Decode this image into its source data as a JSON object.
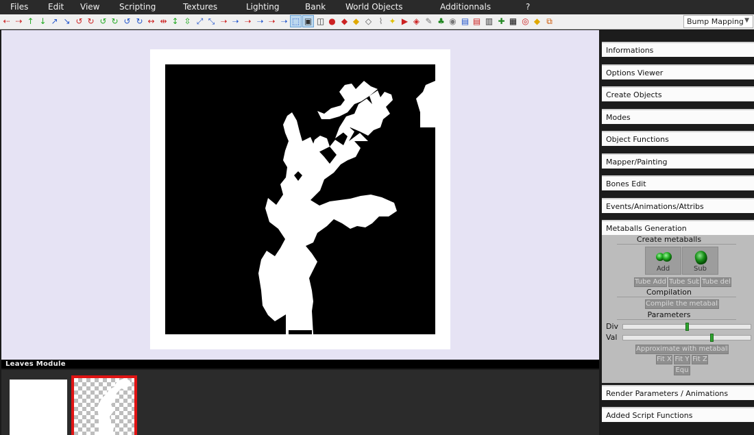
{
  "menu": [
    "Files",
    "Edit",
    "View",
    "Scripting",
    "Textures",
    "Lighting",
    "Bank",
    "World Objects",
    "Additionnals",
    "?"
  ],
  "toolbar": {
    "icons": [
      {
        "name": "arrow-left-icon",
        "glyph": "⇠",
        "color": "#cc2222"
      },
      {
        "name": "arrow-right-icon",
        "glyph": "⇢",
        "color": "#cc2222"
      },
      {
        "name": "axis-y-up-icon",
        "glyph": "↑",
        "color": "#22aa22"
      },
      {
        "name": "axis-y-down-icon",
        "glyph": "↓",
        "color": "#22aa22"
      },
      {
        "name": "axis-z-up-icon",
        "glyph": "↗",
        "color": "#2255cc"
      },
      {
        "name": "axis-z-down-icon",
        "glyph": "↘",
        "color": "#2255cc"
      },
      {
        "name": "rotate-x-icon",
        "glyph": "↺",
        "color": "#cc2222"
      },
      {
        "name": "rotate-x-back-icon",
        "glyph": "↻",
        "color": "#cc2222"
      },
      {
        "name": "rotate-y-icon",
        "glyph": "↺",
        "color": "#22aa22"
      },
      {
        "name": "rotate-y-back-icon",
        "glyph": "↻",
        "color": "#22aa22"
      },
      {
        "name": "rotate-z-icon",
        "glyph": "↺",
        "color": "#2255cc"
      },
      {
        "name": "rotate-z-back-icon",
        "glyph": "↻",
        "color": "#2255cc"
      },
      {
        "name": "scale-x-icon",
        "glyph": "↔",
        "color": "#cc2222"
      },
      {
        "name": "scale-x-down-icon",
        "glyph": "⇹",
        "color": "#cc2222"
      },
      {
        "name": "scale-y-icon",
        "glyph": "↕",
        "color": "#22aa22"
      },
      {
        "name": "scale-y-down-icon",
        "glyph": "⇳",
        "color": "#22aa22"
      },
      {
        "name": "scale-z-icon",
        "glyph": "⤢",
        "color": "#2255cc"
      },
      {
        "name": "scale-z-down-icon",
        "glyph": "⤡",
        "color": "#2255cc"
      },
      {
        "name": "move-x-icon",
        "glyph": "➝",
        "color": "#cc2222"
      },
      {
        "name": "move-y-icon",
        "glyph": "➝",
        "color": "#2255cc"
      },
      {
        "name": "move-z-icon",
        "glyph": "➝",
        "color": "#cc2222"
      },
      {
        "name": "move-x-back-icon",
        "glyph": "➝",
        "color": "#2255cc"
      },
      {
        "name": "move-y-back-icon",
        "glyph": "➝",
        "color": "#cc2222"
      },
      {
        "name": "move-z-back-icon",
        "glyph": "➝",
        "color": "#2255cc"
      },
      {
        "name": "select-mode-icon",
        "glyph": "⬚",
        "color": "#2255cc",
        "active": true
      },
      {
        "name": "box-select-icon",
        "glyph": "▣",
        "color": "#333333",
        "active": true
      },
      {
        "name": "cube-icon",
        "glyph": "◫",
        "color": "#333333"
      },
      {
        "name": "sphere-icon",
        "glyph": "●",
        "color": "#cc2222"
      },
      {
        "name": "diamond-icon",
        "glyph": "◆",
        "color": "#cc2222"
      },
      {
        "name": "diamond-yellow-icon",
        "glyph": "◆",
        "color": "#e0a800"
      },
      {
        "name": "diamond-outline-icon",
        "glyph": "◇",
        "color": "#555555"
      },
      {
        "name": "bone-icon",
        "glyph": "⌇",
        "color": "#777777"
      },
      {
        "name": "light-bulb-icon",
        "glyph": "✦",
        "color": "#e0c000"
      },
      {
        "name": "play-icon",
        "glyph": "▶",
        "color": "#cc2222"
      },
      {
        "name": "paint-bucket-icon",
        "glyph": "◈",
        "color": "#cc2222"
      },
      {
        "name": "brush-icon",
        "glyph": "✎",
        "color": "#777777"
      },
      {
        "name": "tree-icon",
        "glyph": "♣",
        "color": "#228822"
      },
      {
        "name": "disk-icon",
        "glyph": "◉",
        "color": "#777777"
      },
      {
        "name": "doc-blue-icon",
        "glyph": "▤",
        "color": "#2255cc"
      },
      {
        "name": "doc-red-icon",
        "glyph": "▤",
        "color": "#cc2222"
      },
      {
        "name": "script-icon",
        "glyph": "▥",
        "color": "#333333"
      },
      {
        "name": "plugin-icon",
        "glyph": "✚",
        "color": "#228822"
      },
      {
        "name": "window-icon",
        "glyph": "▦",
        "color": "#111111"
      },
      {
        "name": "stop-icon",
        "glyph": "◎",
        "color": "#cc2222"
      },
      {
        "name": "tag-icon",
        "glyph": "◆",
        "color": "#e0a800"
      },
      {
        "name": "export-icon",
        "glyph": "⧉",
        "color": "#cc5500"
      }
    ],
    "render_mode": "Bump Mapping"
  },
  "leaves_module": {
    "title": "Leaves Module"
  },
  "panel": {
    "sections_top": [
      "Informations",
      "Options Viewer",
      "Create Objects",
      "Modes",
      "Object Functions",
      "Mapper/Painting",
      "Bones Edit",
      "Events/Animations/Attribs",
      "Metaballs Generation"
    ],
    "metaballs": {
      "create_title": "Create metaballs",
      "add_label": "Add",
      "sub_label": "Sub",
      "tube_add": "Tube Add",
      "tube_sub": "Tube Sub",
      "tube_del": "Tube del",
      "compilation_title": "Compilation",
      "compile_label": "Compile the metaballs",
      "parameters_title": "Parameters",
      "div_label": "Div",
      "div_value": 0.5,
      "val_label": "Val",
      "val_value": 0.7,
      "approx_label": "Approximate with metaballs",
      "fit_x": "Fit X",
      "fit_y": "Fit Y",
      "fit_z": "Fit Z",
      "equ": "Equ"
    },
    "sections_bottom": [
      "Render Parameters / Animations",
      "Added Script Functions"
    ]
  }
}
